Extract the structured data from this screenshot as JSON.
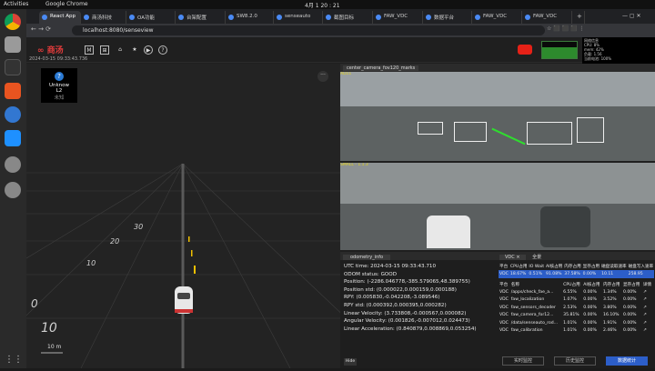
{
  "topbar": {
    "activities": "Activities",
    "browser": "Google Chrome",
    "clock": "4月 1  20 : 21"
  },
  "tabs": [
    {
      "label": "React App"
    },
    {
      "label": "商汤科技"
    },
    {
      "label": "OA功能"
    },
    {
      "label": "台架配置"
    },
    {
      "label": "SW8.2.0"
    },
    {
      "label": "senseauto"
    },
    {
      "label": "截图目标"
    },
    {
      "label": "FAW_VDC"
    },
    {
      "label": "数据平台"
    },
    {
      "label": "FAW_VDC"
    },
    {
      "label": "FAW_VDC"
    }
  ],
  "address": {
    "url": "localhost:8080/senseview"
  },
  "app": {
    "logo_text": "商汤",
    "timestamp": "2024-03-15 09:33:43.736",
    "header_buttons": [
      {
        "label": "M",
        "icon": "map-icon"
      },
      {
        "label": "⊞",
        "icon": "grid-icon"
      },
      {
        "label": "⌂",
        "icon": "home-icon"
      },
      {
        "label": "★",
        "icon": "star-icon"
      },
      {
        "label": "▶",
        "icon": "play-icon"
      },
      {
        "label": "?",
        "icon": "help-icon"
      }
    ]
  },
  "view3d": {
    "badge": {
      "icon": "?",
      "title": "Unknow",
      "level": "L2",
      "sub": "未知"
    },
    "scale_label": "10 m",
    "ring_labels": [
      "30",
      "20",
      "10",
      "0",
      "10"
    ],
    "more_icon": "···"
  },
  "camera": {
    "title": "center_camera_fov120_marks",
    "top_label": "AD11",
    "bottom_label": "SMALL - 1.1.3"
  },
  "odometry": {
    "title": "odometry_info",
    "lines": [
      "UTC time: 2024-03-15 09:33:43.710",
      "ODOM status: GOOD",
      "Position: (-2286.046778,-385.579065,48.389755)",
      "Position std: (0.000022,0.000159,0.000188)",
      "RPY: (0.005830,-0.042208,-3.089546)",
      "RPY std: (0.000392,0.000395,0.000282)",
      "Linear Velocity: (3.733808,-0.000567,0.000082)",
      "Angular Velocity: (0.001826,-0.007012,0.024473)",
      "Linear Acceleration: (0.840879,0.008869,0.053254)"
    ],
    "footer_button": "Hide"
  },
  "vdc": {
    "title": "VDC ×",
    "tab2": "全景",
    "header": [
      "平台",
      "CPU占用",
      "IO Wait",
      "AI核占用",
      "内存占用",
      "显存占用",
      "磁盘读取速率",
      "磁盘写入速率"
    ],
    "summary": [
      "VDC",
      "18.67%",
      "0.51%",
      "91.08%",
      "37.58%",
      "0.00%",
      "10.11",
      "258.95"
    ],
    "proc_header": [
      "平台",
      "名称",
      "CPU占用",
      "AI核占用",
      "内存占用",
      "显存占用",
      "详情"
    ],
    "rows": [
      [
        "VDC",
        "/apps/check_fae_a...",
        "6.55%",
        "0.00%",
        "1.34%",
        "0.00%"
      ],
      [
        "VDC",
        "faw_localization",
        "1.07%",
        "0.00%",
        "3.52%",
        "0.00%"
      ],
      [
        "VDC",
        "faw_sensors_decoder",
        "2.53%",
        "0.00%",
        "3.80%",
        "0.00%"
      ],
      [
        "VDC",
        "faw_camera_for12...",
        "35.81%",
        "0.00%",
        "16.10%",
        "0.00%"
      ],
      [
        "VDC",
        "/data/senseauto_rod...",
        "1.01%",
        "0.00%",
        "1.91%",
        "0.00%"
      ],
      [
        "VDC",
        "faw_calibration",
        "1.01%",
        "0.00%",
        "2.46%",
        "0.00%"
      ]
    ],
    "bottom_tabs": [
      "实时监控",
      "历史监控",
      "数据统计"
    ]
  },
  "sysinfo": {
    "lines": [
      "网络信息",
      "CPU: 8%",
      "mem: 42%",
      "负载: 1.56",
      "当前电池: 100%",
      "温度: 51℃"
    ]
  }
}
